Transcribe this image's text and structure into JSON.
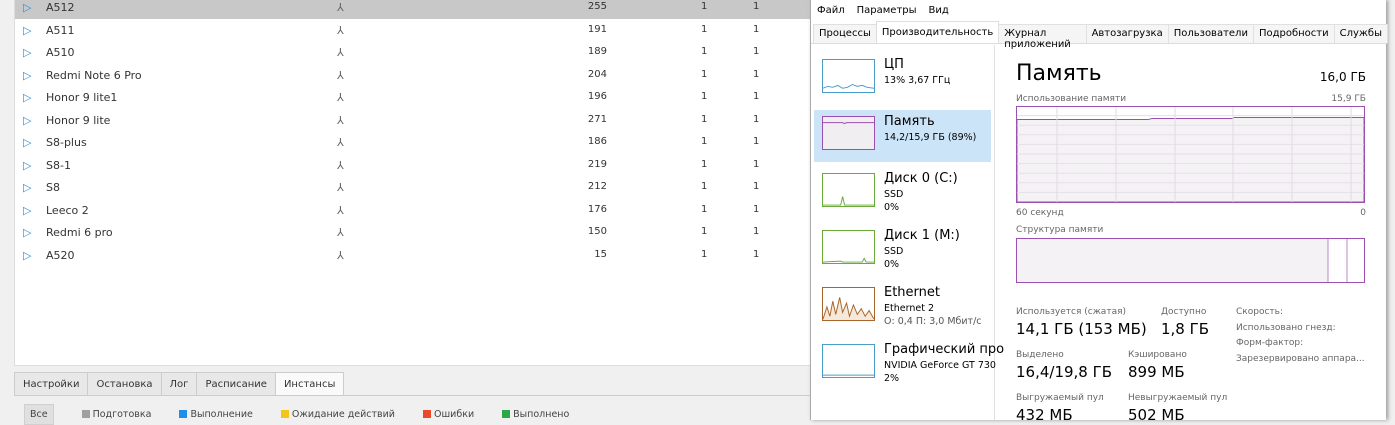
{
  "instances": {
    "rows": [
      {
        "name": "A512",
        "count": "255",
        "c1": "1",
        "c2": "1",
        "selected": true
      },
      {
        "name": "A511",
        "count": "191",
        "c1": "1",
        "c2": "1"
      },
      {
        "name": "A510",
        "count": "189",
        "c1": "1",
        "c2": "1"
      },
      {
        "name": "Redmi Note 6 Pro",
        "count": "204",
        "c1": "1",
        "c2": "1"
      },
      {
        "name": "Honor 9 lite1",
        "count": "196",
        "c1": "1",
        "c2": "1"
      },
      {
        "name": "Honor 9 lite",
        "count": "271",
        "c1": "1",
        "c2": "1"
      },
      {
        "name": "S8-plus",
        "count": "186",
        "c1": "1",
        "c2": "1"
      },
      {
        "name": "S8-1",
        "count": "219",
        "c1": "1",
        "c2": "1"
      },
      {
        "name": "S8",
        "count": "212",
        "c1": "1",
        "c2": "1"
      },
      {
        "name": "Leeco 2",
        "count": "176",
        "c1": "1",
        "c2": "1"
      },
      {
        "name": "Redmi 6 pro",
        "count": "150",
        "c1": "1",
        "c2": "1"
      },
      {
        "name": "A520",
        "count": "15",
        "c1": "1",
        "c2": "1"
      }
    ],
    "tabs": [
      "Настройки",
      "Остановка",
      "Лог",
      "Расписание",
      "Инстансы"
    ],
    "active_tab": "Инстансы",
    "filters": [
      {
        "label": "Все"
      },
      {
        "label": "Подготовка",
        "color": "#a0a0a0"
      },
      {
        "label": "Выполнение",
        "color": "#1e90e8"
      },
      {
        "label": "Ожидание действий",
        "color": "#f5c518"
      },
      {
        "label": "Ошибки",
        "color": "#e84a2a"
      },
      {
        "label": "Выполнено",
        "color": "#2aa84a"
      }
    ]
  },
  "taskmgr": {
    "menu": [
      "Файл",
      "Параметры",
      "Вид"
    ],
    "tabs": [
      "Процессы",
      "Производительность",
      "Журнал приложений",
      "Автозагрузка",
      "Пользователи",
      "Подробности",
      "Службы"
    ],
    "active_tab": "Производительность",
    "sidebar": [
      {
        "title": "ЦП",
        "l1": "13% 3,67 ГГц",
        "l2": "",
        "color": "#4a9cc8"
      },
      {
        "title": "Память",
        "l1": "14,2/15,9 ГБ (89%)",
        "l2": "",
        "color": "#9b4fb0",
        "selected": true
      },
      {
        "title": "Диск 0 (C:)",
        "l1": "SSD",
        "l2": "0%",
        "color": "#6aaa3a"
      },
      {
        "title": "Диск 1 (M:)",
        "l1": "SSD",
        "l2": "0%",
        "color": "#6aaa3a"
      },
      {
        "title": "Ethernet",
        "l1": "Ethernet 2",
        "l2": "О: 0,4 П: 3,0 Мбит/с",
        "color": "#a8662a"
      },
      {
        "title": "Графический про",
        "l1": "NVIDIA GeForce GT 730",
        "l2": "2%",
        "color": "#4a9cc8"
      }
    ],
    "memory": {
      "title": "Память",
      "total": "16,0 ГБ",
      "usage_label": "Использование памяти",
      "usage_max": "15,9 ГБ",
      "usage_fraction": 0.89,
      "time_left": "60 секунд",
      "time_right": "0",
      "structure_label": "Структура памяти",
      "stats": [
        {
          "label": "Используется (сжатая)",
          "value": "14,1 ГБ (153 МБ)"
        },
        {
          "label": "Доступно",
          "value": "1,8 ГБ"
        },
        {
          "label": "Выделено",
          "value": "16,4/19,8 ГБ"
        },
        {
          "label": "Кэшировано",
          "value": "899 МБ"
        },
        {
          "label": "Выгружаемый пул",
          "value": "432 МБ"
        },
        {
          "label": "Невыгружаемый пул",
          "value": "502 МБ"
        }
      ],
      "props": [
        "Скорость:",
        "Использовано гнезд:",
        "Форм-фактор:",
        "Зарезервировано аппара..."
      ]
    }
  }
}
